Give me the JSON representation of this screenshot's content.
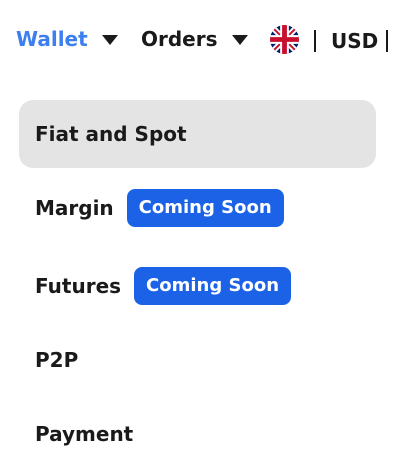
{
  "nav": {
    "wallet_label": "Wallet",
    "orders_label": "Orders",
    "currency": "USD",
    "active_color": "#3d7ef0"
  },
  "wallet_menu": {
    "items": [
      {
        "label": "Fiat and Spot",
        "selected": true
      },
      {
        "label": "Margin",
        "badge": "Coming Soon"
      },
      {
        "label": "Futures",
        "badge": "Coming Soon"
      },
      {
        "label": "P2P"
      },
      {
        "label": "Payment"
      }
    ],
    "badge_color": "#1c62e6",
    "selected_bg": "#e4e4e4"
  },
  "icons": {
    "language": "uk-flag-icon",
    "dropdown": "caret-down-icon"
  }
}
